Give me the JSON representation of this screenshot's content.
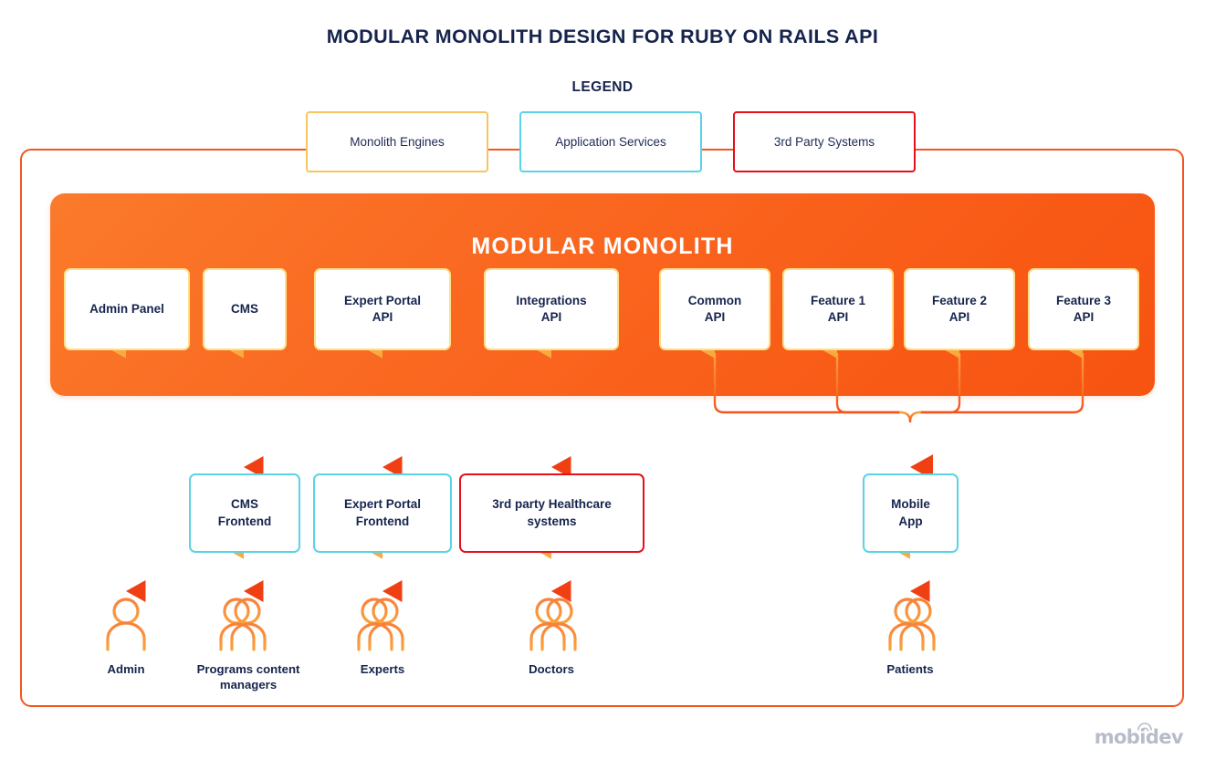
{
  "title": "MODULAR MONOLITH DESIGN FOR RUBY ON RAILS API",
  "legend": {
    "heading": "LEGEND",
    "items": [
      {
        "label": "Monolith Engines",
        "color": "#f6c560",
        "kind": "monolith-engines"
      },
      {
        "label": "Application Services",
        "color": "#5ad3e6",
        "kind": "application-services"
      },
      {
        "label": "3rd Party Systems",
        "color": "#e60f1b",
        "kind": "third-party-systems"
      }
    ]
  },
  "monolith": {
    "heading": "MODULAR MONOLITH",
    "fill_start": "#fb7a2b",
    "fill_end": "#f75311",
    "modules": [
      {
        "label": "Admin Panel",
        "line1": "Admin Panel",
        "line2": ""
      },
      {
        "label": "CMS",
        "line1": "CMS",
        "line2": ""
      },
      {
        "label": "Expert Portal API",
        "line1": "Expert Portal",
        "line2": "API"
      },
      {
        "label": "Integrations API",
        "line1": "Integrations",
        "line2": "API"
      },
      {
        "label": "Common API",
        "line1": "Common",
        "line2": "API"
      },
      {
        "label": "Feature 1 API",
        "line1": "Feature 1",
        "line2": "API"
      },
      {
        "label": "Feature 2 API",
        "line1": "Feature 2",
        "line2": "API"
      },
      {
        "label": "Feature 3 API",
        "line1": "Feature 3",
        "line2": "API"
      }
    ]
  },
  "consumers": [
    {
      "label": "CMS Frontend",
      "line1": "CMS",
      "line2": "Frontend",
      "kind": "application-services"
    },
    {
      "label": "Expert Portal Frontend",
      "line1": "Expert Portal",
      "line2": "Frontend",
      "kind": "application-services"
    },
    {
      "label": "3rd party Healthcare systems",
      "line1": "3rd party Healthcare",
      "line2": "systems",
      "kind": "third-party-systems"
    },
    {
      "label": "Mobile App",
      "line1": "Mobile",
      "line2": "App",
      "kind": "application-services"
    }
  ],
  "actors": [
    {
      "label": "Admin",
      "line1": "Admin",
      "line2": "",
      "icon": "user-icon"
    },
    {
      "label": "Programs content managers",
      "line1": "Programs content",
      "line2": "managers",
      "icon": "users-icon"
    },
    {
      "label": "Experts",
      "line1": "Experts",
      "line2": "",
      "icon": "users-icon"
    },
    {
      "label": "Doctors",
      "line1": "Doctors",
      "line2": "",
      "icon": "users-icon"
    },
    {
      "label": "Patients",
      "line1": "Patients",
      "line2": "",
      "icon": "users-icon"
    }
  ],
  "colors": {
    "orange_border": "#f4551f",
    "arrow_top": "#fbb040",
    "arrow_bottom": "#ef3f13",
    "text": "#16244d",
    "module_border": "#fde08a"
  },
  "branding": {
    "logo_text": "mobidev"
  }
}
